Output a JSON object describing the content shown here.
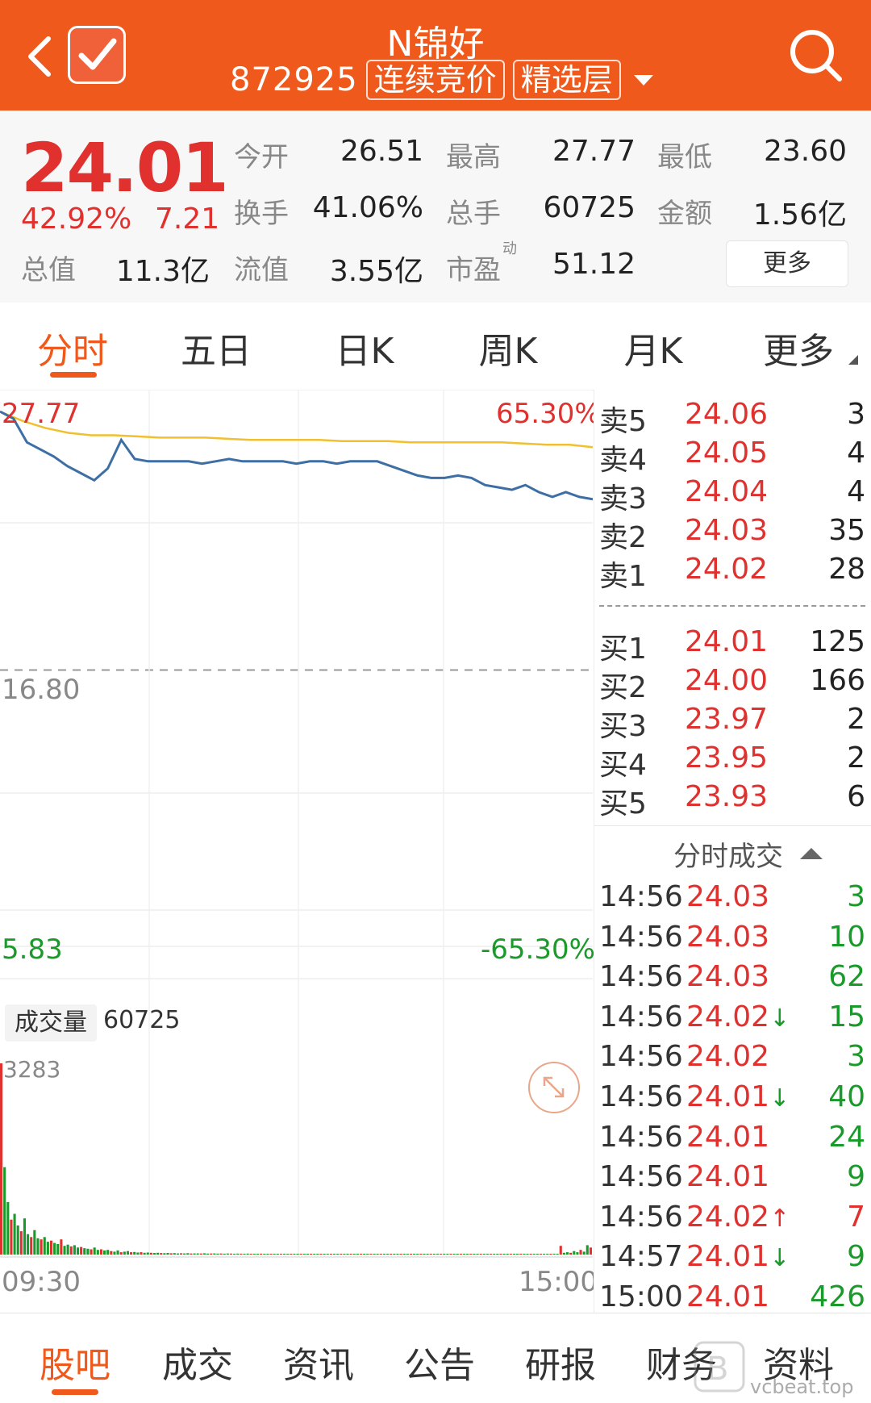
{
  "header": {
    "name": "N锦好",
    "code": "872925",
    "tags": [
      "连续竞价",
      "精选层"
    ]
  },
  "quote": {
    "price": "24.01",
    "change_pct": "42.92%",
    "change": "7.21",
    "rows": [
      [
        {
          "label": "今开",
          "value": "26.51",
          "color": "red"
        },
        {
          "label": "最高",
          "value": "27.77",
          "color": "red"
        },
        {
          "label": "最低",
          "value": "23.60",
          "color": "red"
        }
      ],
      [
        {
          "label": "换手",
          "value": "41.06%",
          "color": "dark"
        },
        {
          "label": "总手",
          "value": "60725",
          "color": "dark"
        },
        {
          "label": "金额",
          "value": "1.56亿",
          "color": "dark"
        }
      ],
      [
        {
          "label": "总值",
          "value": "11.3亿",
          "color": "dark"
        },
        {
          "label": "流值",
          "value": "3.55亿",
          "color": "dark"
        },
        {
          "label": "市盈",
          "value": "51.12",
          "color": "dark"
        }
      ]
    ],
    "pe_superscript": "动",
    "more_label": "更多"
  },
  "tabs": [
    "分时",
    "五日",
    "日K",
    "周K",
    "月K",
    "更多"
  ],
  "chart_data": {
    "type": "line",
    "title": "",
    "xlabel": "",
    "ylabel": "",
    "x_ticks": [
      "09:30",
      "15:00"
    ],
    "y_top": "27.77",
    "y_mid": "16.80",
    "y_bottom": "5.83",
    "pct_top": "65.30%",
    "pct_bottom": "-65.30%",
    "ylim": [
      5.83,
      27.77
    ],
    "series": [
      {
        "values": [
          27.7,
          27.4,
          26.4,
          26.1,
          25.8,
          25.4,
          25.1,
          24.8,
          25.3,
          26.5,
          25.7,
          25.6,
          25.6,
          25.6,
          25.6,
          25.5,
          25.6,
          25.7,
          25.6,
          25.6,
          25.6,
          25.6,
          25.5,
          25.6,
          25.6,
          25.5,
          25.6,
          25.6,
          25.6,
          25.4,
          25.2,
          25.0,
          24.9,
          24.9,
          25.0,
          24.9,
          24.6,
          24.5,
          24.4,
          24.6,
          24.3,
          24.1,
          24.3,
          24.1,
          24.0
        ]
      },
      {
        "values": [
          27.7,
          27.3,
          27.0,
          26.8,
          26.7,
          26.7,
          26.65,
          26.6,
          26.6,
          26.6,
          26.55,
          26.5,
          26.5,
          26.5,
          26.5,
          26.45,
          26.45,
          26.45,
          26.4,
          26.4,
          26.4,
          26.4,
          26.4,
          26.35,
          26.3,
          26.3,
          26.2
        ]
      }
    ],
    "volume": {
      "label": "成交量",
      "total": "60725",
      "max": "3283",
      "values": [
        3283,
        1500,
        900,
        600,
        700,
        500,
        400,
        620,
        350,
        300,
        420,
        280,
        260,
        300,
        220,
        240,
        200,
        180,
        260,
        150,
        170,
        140,
        160,
        120,
        130,
        110,
        100,
        90,
        120,
        80,
        90,
        70,
        80,
        60,
        50,
        70,
        40,
        50,
        60,
        40,
        45,
        35,
        40,
        30,
        35,
        30,
        28,
        30,
        26,
        24,
        28,
        22,
        25,
        20,
        22,
        20,
        24,
        18,
        20,
        20,
        18,
        22,
        16,
        18,
        20,
        16,
        18,
        15,
        18,
        16,
        14,
        16,
        15,
        14,
        16,
        14,
        12,
        14,
        15,
        12,
        14,
        12,
        13,
        12,
        14,
        12,
        11,
        12,
        10,
        12,
        11,
        10,
        12,
        10,
        11,
        10,
        12,
        10,
        9,
        10,
        11,
        10,
        9,
        10,
        9,
        10,
        9,
        10,
        9,
        8,
        10,
        9,
        8,
        9,
        10,
        8,
        9,
        8,
        9,
        10,
        8,
        9,
        8,
        9,
        8,
        9,
        8,
        9,
        10,
        8,
        9,
        8,
        10,
        9,
        8,
        9,
        10,
        9,
        8,
        9,
        10,
        9,
        8,
        9,
        8,
        10,
        9,
        8,
        9,
        10,
        8,
        9,
        12,
        10,
        9,
        10,
        12,
        10,
        11,
        10,
        12,
        11,
        10,
        12,
        14,
        10,
        12,
        11,
        150,
        30,
        40,
        30,
        60,
        40,
        80,
        50,
        160,
        120
      ]
    }
  },
  "order_book": {
    "asks": [
      {
        "label": "卖5",
        "price": "24.06",
        "qty": "3"
      },
      {
        "label": "卖4",
        "price": "24.05",
        "qty": "4"
      },
      {
        "label": "卖3",
        "price": "24.04",
        "qty": "4"
      },
      {
        "label": "卖2",
        "price": "24.03",
        "qty": "35"
      },
      {
        "label": "卖1",
        "price": "24.02",
        "qty": "28"
      }
    ],
    "bids": [
      {
        "label": "买1",
        "price": "24.01",
        "qty": "125"
      },
      {
        "label": "买2",
        "price": "24.00",
        "qty": "166"
      },
      {
        "label": "买3",
        "price": "23.97",
        "qty": "2"
      },
      {
        "label": "买4",
        "price": "23.95",
        "qty": "2"
      },
      {
        "label": "买5",
        "price": "23.93",
        "qty": "6"
      }
    ]
  },
  "ticks": {
    "title": "分时成交",
    "rows": [
      {
        "time": "14:56",
        "price": "24.03",
        "arrow": "",
        "qty": "3",
        "qcolor": "green"
      },
      {
        "time": "14:56",
        "price": "24.03",
        "arrow": "",
        "qty": "10",
        "qcolor": "green"
      },
      {
        "time": "14:56",
        "price": "24.03",
        "arrow": "",
        "qty": "62",
        "qcolor": "green"
      },
      {
        "time": "14:56",
        "price": "24.02",
        "arrow": "↓",
        "qty": "15",
        "qcolor": "green"
      },
      {
        "time": "14:56",
        "price": "24.02",
        "arrow": "",
        "qty": "3",
        "qcolor": "green"
      },
      {
        "time": "14:56",
        "price": "24.01",
        "arrow": "↓",
        "qty": "40",
        "qcolor": "green"
      },
      {
        "time": "14:56",
        "price": "24.01",
        "arrow": "",
        "qty": "24",
        "qcolor": "green"
      },
      {
        "time": "14:56",
        "price": "24.01",
        "arrow": "",
        "qty": "9",
        "qcolor": "green"
      },
      {
        "time": "14:56",
        "price": "24.02",
        "arrow": "↑",
        "qty": "7",
        "qcolor": "red"
      },
      {
        "time": "14:57",
        "price": "24.01",
        "arrow": "↓",
        "qty": "9",
        "qcolor": "green"
      },
      {
        "time": "15:00",
        "price": "24.01",
        "arrow": "",
        "qty": "426",
        "qcolor": "green"
      }
    ]
  },
  "bottom_nav": [
    "股吧",
    "成交",
    "资讯",
    "公告",
    "研报",
    "财务",
    "资料"
  ],
  "watermark": "vcbeat.top",
  "colors": {
    "brand": "#ef5a1c",
    "up": "#e0312f",
    "down": "#1a9a2a",
    "price_line": "#3d6fa5",
    "avg_line": "#f0c030"
  }
}
